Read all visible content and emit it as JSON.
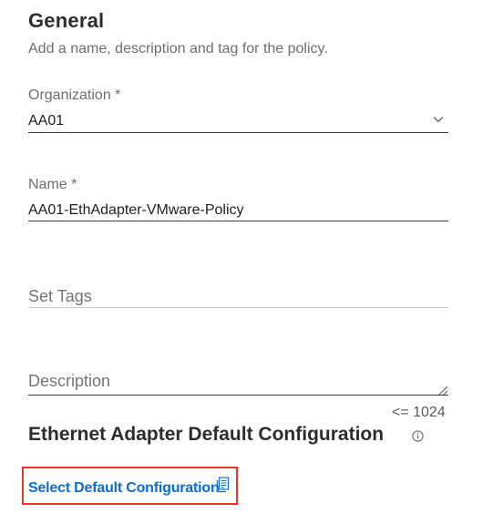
{
  "general": {
    "title": "General",
    "subtitle": "Add a name, description and tag for the policy."
  },
  "organization": {
    "label": "Organization *",
    "value": "AA01",
    "icon": "chevron-down-icon"
  },
  "name": {
    "label": "Name *",
    "value": "AA01-EthAdapter-VMware-Policy"
  },
  "tags": {
    "placeholder": "Set Tags"
  },
  "description": {
    "placeholder": "Description",
    "limit": "<= 1024",
    "icon": "resize-handle-icon"
  },
  "ethernet": {
    "title": "Ethernet Adapter Default Configuration",
    "info_icon": "info-icon",
    "select_label": "Select Default Configuration",
    "select_icon": "clipboard-icon",
    "highlight_color": "#e0392b",
    "link_color": "#0a6ed1"
  }
}
